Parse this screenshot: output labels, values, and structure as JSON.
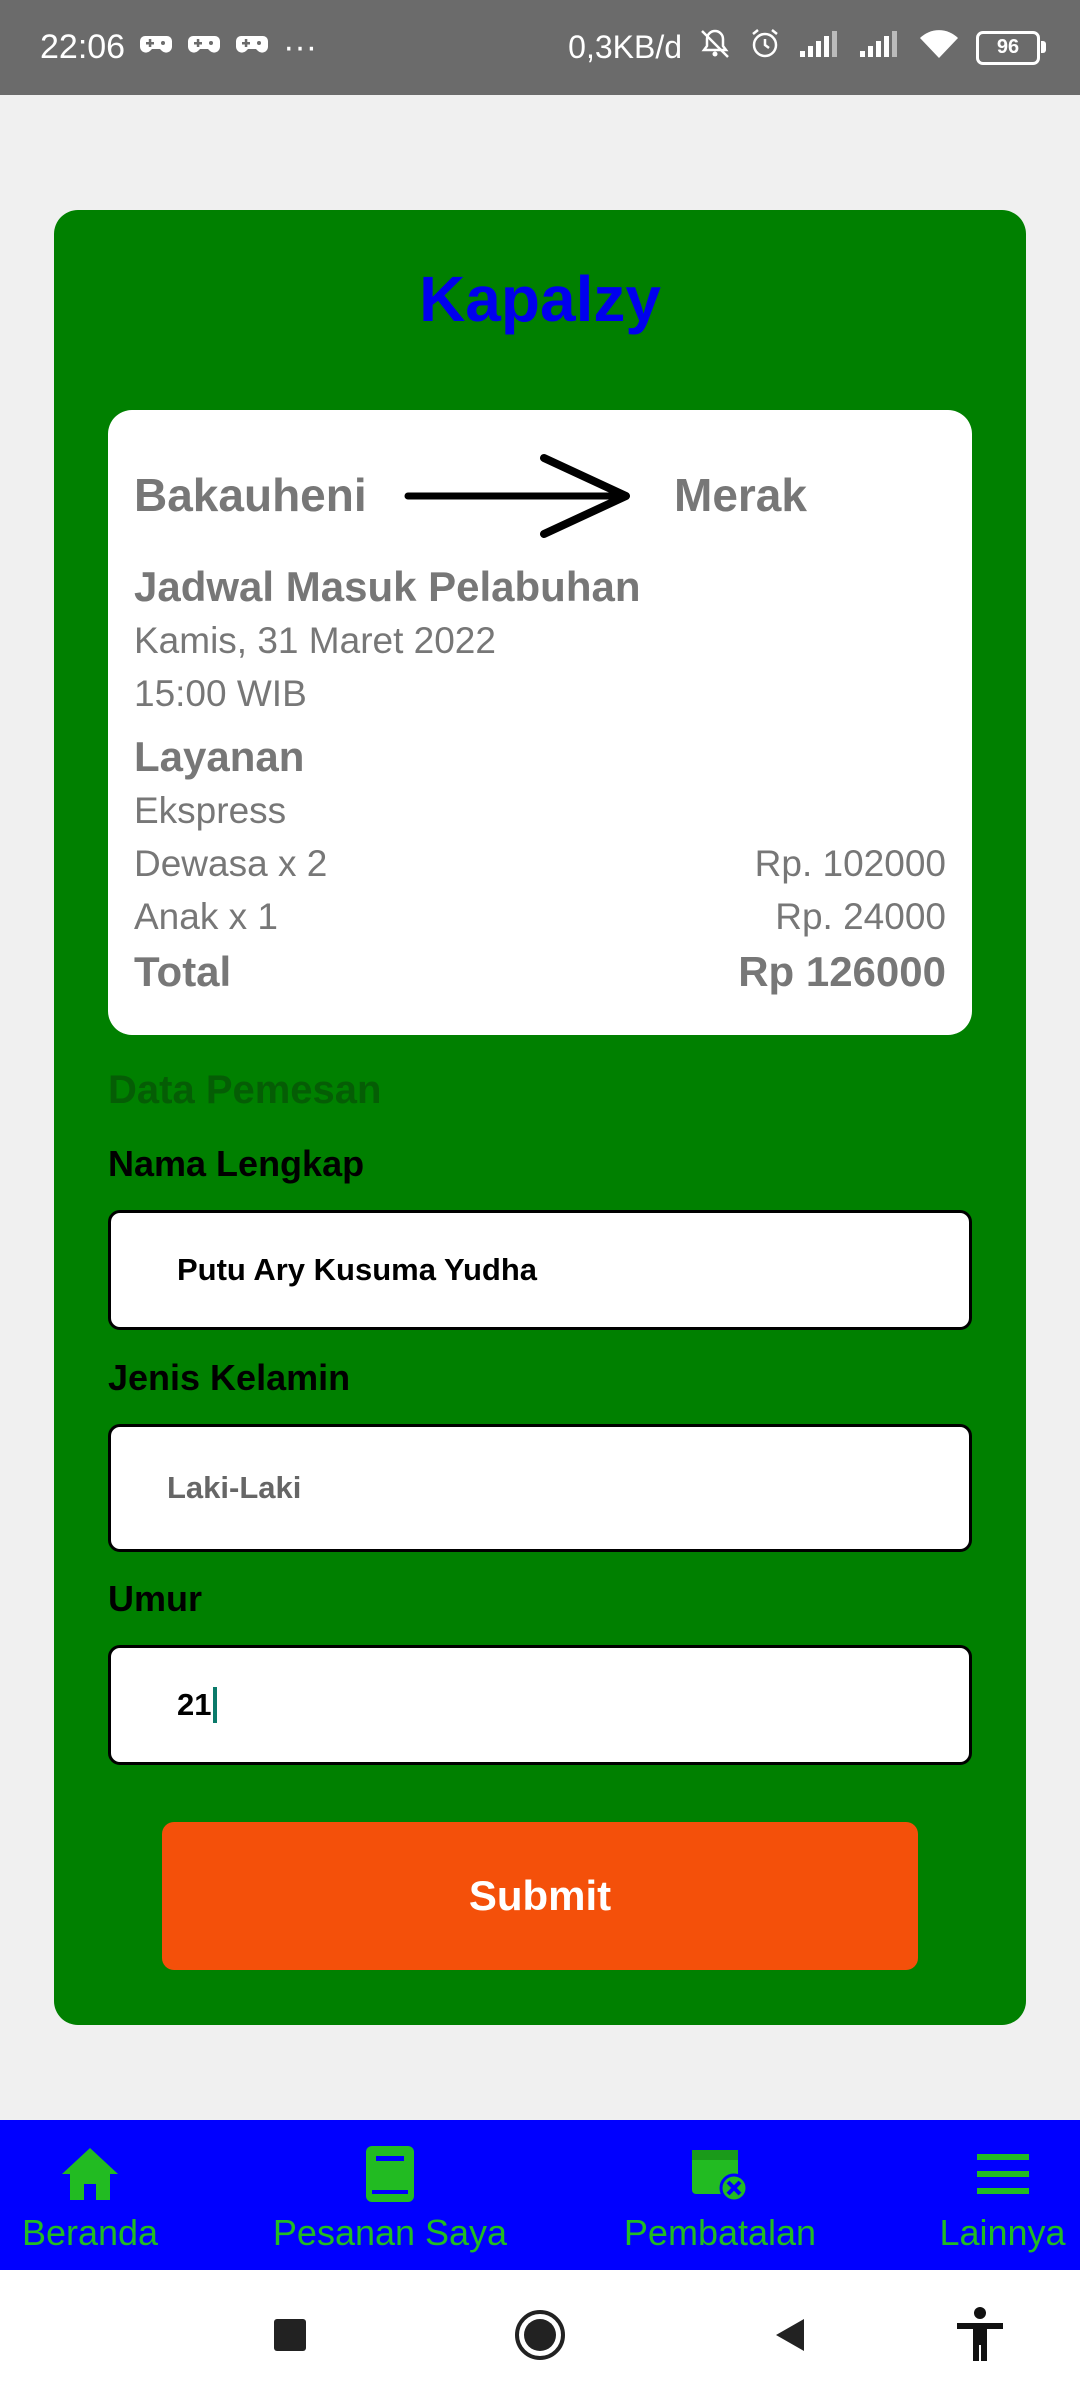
{
  "status_bar": {
    "time": "22:06",
    "more": "···",
    "data_rate": "0,3KB/d",
    "battery": "96"
  },
  "app": {
    "brand": "Kapalzy"
  },
  "ticket": {
    "from": "Bakauheni",
    "to": "Merak",
    "schedule_label": "Jadwal Masuk Pelabuhan",
    "date": "Kamis, 31 Maret 2022",
    "time": "15:00 WIB",
    "service_label": "Layanan",
    "service": "Ekspress",
    "adult_line": "Dewasa x 2",
    "adult_price": "Rp. 102000",
    "child_line": "Anak x 1",
    "child_price": "Rp. 24000",
    "total_label": "Total",
    "total_value": "Rp 126000"
  },
  "form": {
    "section_title": "Data Pemesan",
    "name_label": "Nama Lengkap",
    "name_value": "Putu Ary Kusuma Yudha",
    "gender_label": "Jenis Kelamin",
    "gender_value": "Laki-Laki",
    "age_label": "Umur",
    "age_value": "21",
    "submit_label": "Submit"
  },
  "bottom_nav": {
    "items": [
      {
        "label": "Beranda",
        "icon": "home-icon"
      },
      {
        "label": "Pesanan Saya",
        "icon": "book-icon"
      },
      {
        "label": "Pembatalan",
        "icon": "calendar-cancel-icon"
      },
      {
        "label": "Lainnya",
        "icon": "menu-icon"
      }
    ]
  },
  "colors": {
    "card": "#008000",
    "brand": "#0000ee",
    "submit": "#f4500a",
    "nav_bg": "#0000ff",
    "nav_fg": "#22bb22"
  }
}
